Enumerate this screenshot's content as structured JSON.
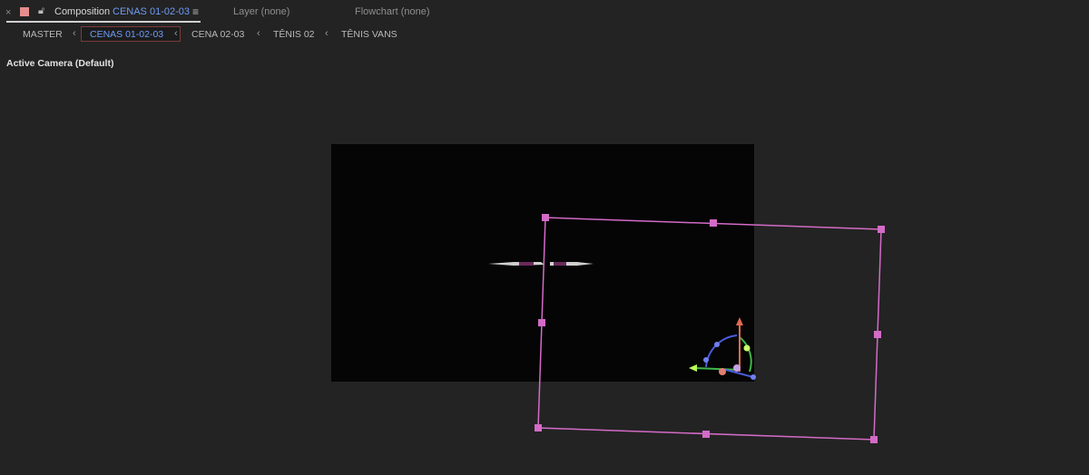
{
  "panel_tabs": {
    "close_symbol": "×",
    "composition_label": "Composition",
    "composition_name": "CENAS 01-02-03",
    "menu_symbol": "≡",
    "layer_tab": "Layer (none)",
    "flowchart_tab": "Flowchart (none)"
  },
  "breadcrumbs": [
    {
      "label": "MASTER"
    },
    {
      "label": "CENAS 01-02-03"
    },
    {
      "label": "CENA 02-03"
    },
    {
      "label": "TÊNIS 02"
    },
    {
      "label": "TÊNIS VANS"
    }
  ],
  "separator": "‹",
  "viewer": {
    "camera_label": "Active Camera (Default)"
  },
  "colors": {
    "accent_blue": "#6f9cf5",
    "selection_magenta": "#d36bc7",
    "label_swatch": "#e58d8d"
  }
}
